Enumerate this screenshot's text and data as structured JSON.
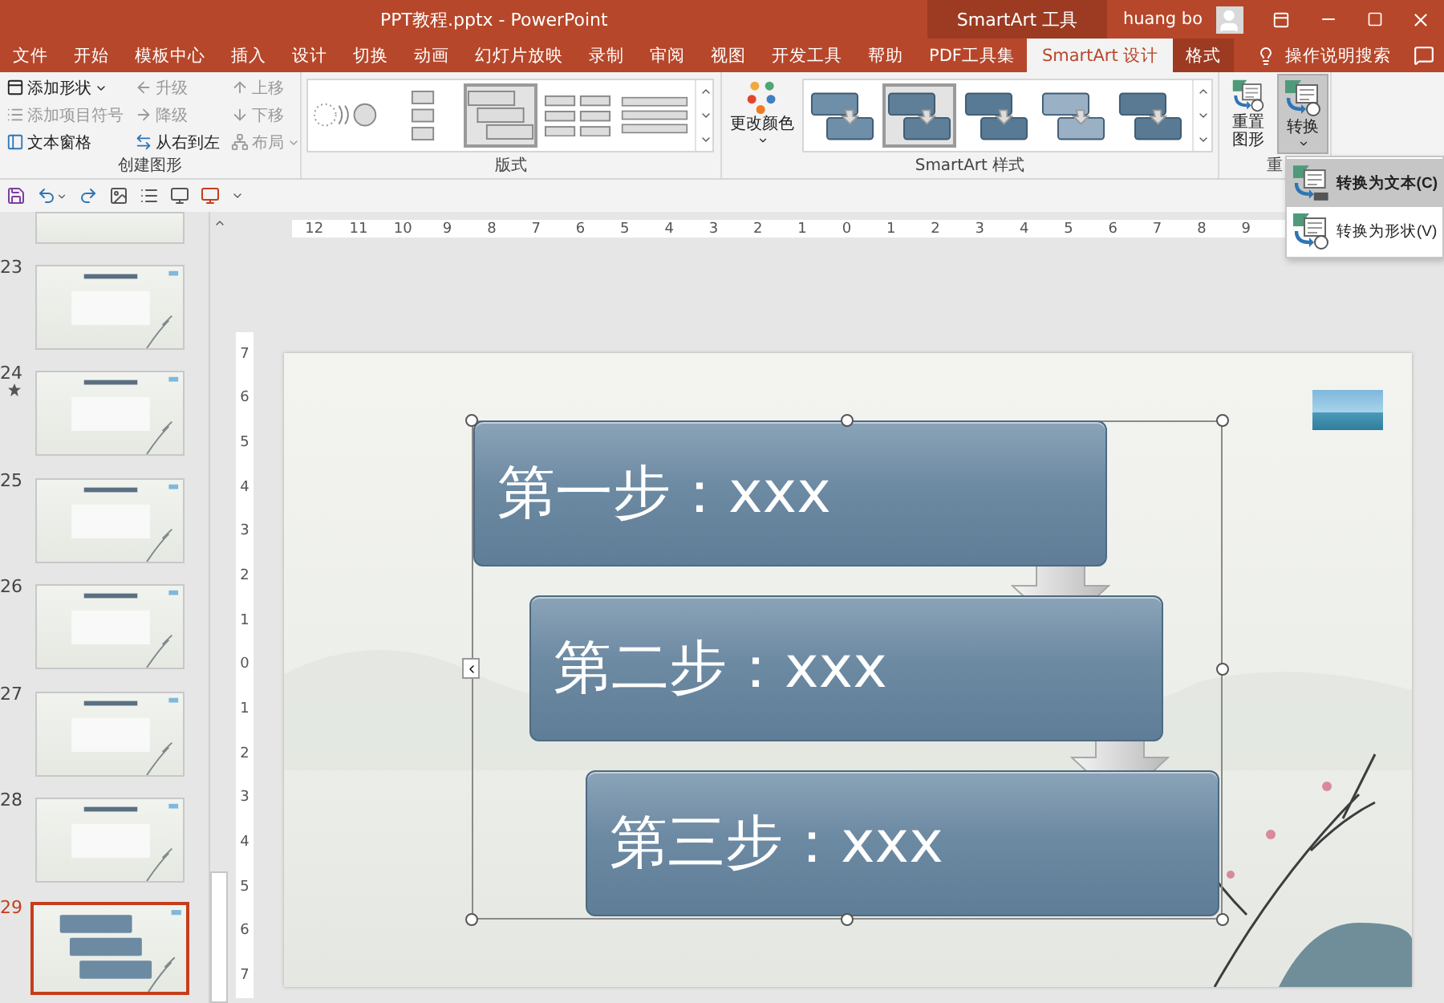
{
  "window": {
    "title": "PPT教程.pptx  -  PowerPoint",
    "context_label": "SmartArt 工具",
    "user": "huang bo"
  },
  "tabs": [
    {
      "label": "文件",
      "selected": false,
      "contextual": false
    },
    {
      "label": "开始",
      "selected": false,
      "contextual": false
    },
    {
      "label": "模板中心",
      "selected": false,
      "contextual": false
    },
    {
      "label": "插入",
      "selected": false,
      "contextual": false
    },
    {
      "label": "设计",
      "selected": false,
      "contextual": false
    },
    {
      "label": "切换",
      "selected": false,
      "contextual": false
    },
    {
      "label": "动画",
      "selected": false,
      "contextual": false
    },
    {
      "label": "幻灯片放映",
      "selected": false,
      "contextual": false
    },
    {
      "label": "录制",
      "selected": false,
      "contextual": false
    },
    {
      "label": "审阅",
      "selected": false,
      "contextual": false
    },
    {
      "label": "视图",
      "selected": false,
      "contextual": false
    },
    {
      "label": "开发工具",
      "selected": false,
      "contextual": false
    },
    {
      "label": "帮助",
      "selected": false,
      "contextual": false
    },
    {
      "label": "PDF工具集",
      "selected": false,
      "contextual": false
    },
    {
      "label": "SmartArt 设计",
      "selected": true,
      "contextual": true
    },
    {
      "label": "格式",
      "selected": false,
      "contextual": true
    }
  ],
  "search": {
    "label": "操作说明搜索"
  },
  "ribbon": {
    "create": {
      "label": "创建图形",
      "columns": [
        [
          {
            "label": "添加形状",
            "disabled": false,
            "dropdown": true
          },
          {
            "label": "添加项目符号",
            "disabled": true,
            "dropdown": false
          },
          {
            "label": "文本窗格",
            "disabled": false,
            "dropdown": false
          }
        ],
        [
          {
            "label": "升级",
            "disabled": true,
            "dropdown": false
          },
          {
            "label": "降级",
            "disabled": true,
            "dropdown": false
          },
          {
            "label": "从右到左",
            "disabled": false,
            "dropdown": false
          }
        ],
        [
          {
            "label": "上移",
            "disabled": true,
            "dropdown": false
          },
          {
            "label": "下移",
            "disabled": true,
            "dropdown": false
          },
          {
            "label": "布局",
            "disabled": true,
            "dropdown": true
          }
        ]
      ]
    },
    "layouts": {
      "label": "版式",
      "items": [
        {
          "selected": false
        },
        {
          "selected": false
        },
        {
          "selected": true
        },
        {
          "selected": false
        },
        {
          "selected": false
        }
      ]
    },
    "styles": {
      "label": "SmartArt 样式",
      "color_button": "更改颜色",
      "items": [
        {
          "selected": false
        },
        {
          "selected": true
        },
        {
          "selected": false
        },
        {
          "selected": false
        },
        {
          "selected": false
        }
      ]
    },
    "reset": {
      "label": "重",
      "buttons": [
        {
          "label": "重置图形",
          "pressed": false
        },
        {
          "label": "转换",
          "pressed": true
        }
      ]
    }
  },
  "convert_menu": [
    {
      "label": "转换为文本(C)",
      "selected": true
    },
    {
      "label": "转换为形状(V)",
      "selected": false
    }
  ],
  "ruler": {
    "horizontal": [
      "12",
      "11",
      "10",
      "9",
      "8",
      "7",
      "6",
      "5",
      "4",
      "3",
      "2",
      "1",
      "0",
      "1",
      "2",
      "3",
      "4",
      "5",
      "6",
      "7",
      "8",
      "9"
    ],
    "vertical": [
      "7",
      "6",
      "5",
      "4",
      "3",
      "2",
      "1",
      "0",
      "1",
      "2",
      "3",
      "4",
      "5",
      "6",
      "7"
    ]
  },
  "thumbnails": [
    {
      "number": "23",
      "starred": false,
      "selected": false
    },
    {
      "number": "24",
      "starred": true,
      "selected": false
    },
    {
      "number": "25",
      "starred": false,
      "selected": false
    },
    {
      "number": "26",
      "starred": false,
      "selected": false
    },
    {
      "number": "27",
      "starred": false,
      "selected": false
    },
    {
      "number": "28",
      "starred": false,
      "selected": false
    },
    {
      "number": "29",
      "starred": false,
      "selected": true
    }
  ],
  "slide": {
    "steps": [
      "第一步：xxx",
      "第二步：xxx",
      "第三步：xxx"
    ]
  }
}
